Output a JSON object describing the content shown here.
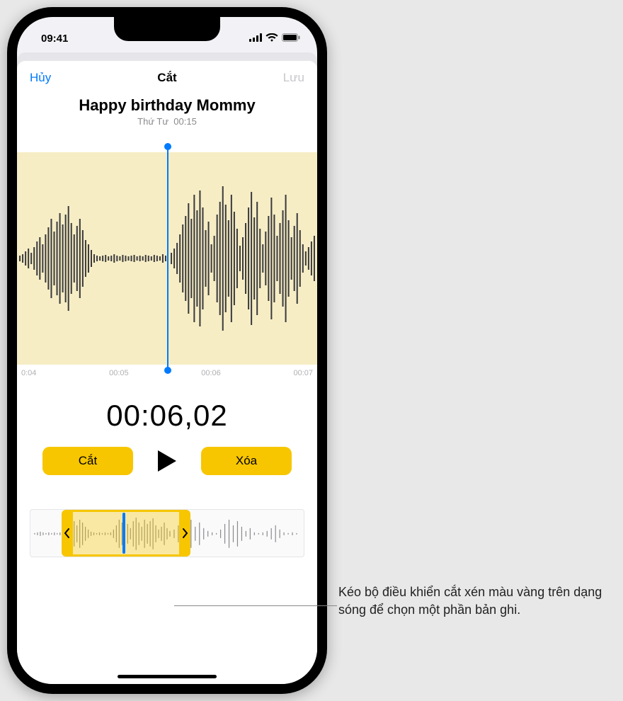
{
  "status": {
    "time": "09:41"
  },
  "nav": {
    "cancel": "Hủy",
    "title": "Cắt",
    "save": "Lưu"
  },
  "recording": {
    "title": "Happy birthday Mommy",
    "day": "Thứ Tư",
    "duration": "00:15"
  },
  "ticks": {
    "t0": "0:04",
    "t1": "00:05",
    "t2": "00:06",
    "t3": "00:07"
  },
  "playback": {
    "timecode": "00:06,02"
  },
  "buttons": {
    "trim": "Cắt",
    "delete": "Xóa"
  },
  "callout": {
    "text": "Kéo bộ điều khiển cắt xén màu vàng trên dạng sóng để chọn một phần bản ghi."
  }
}
